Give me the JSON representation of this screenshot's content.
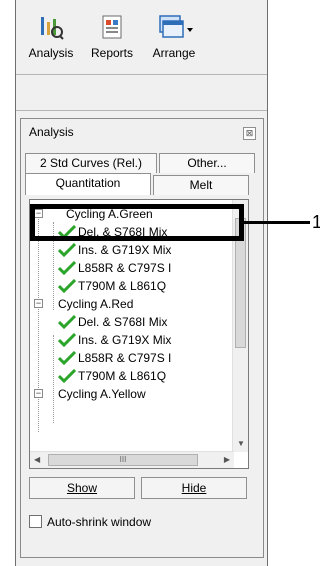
{
  "toolbar": {
    "analysis_label": "Analysis",
    "reports_label": "Reports",
    "arrange_label": "Arrange"
  },
  "dock": {
    "title": "Analysis",
    "close_glyph": "⊠"
  },
  "tabs": {
    "row1": [
      "2 Std Curves (Rel.)",
      "Other..."
    ],
    "row2": [
      "Quantitation",
      "Melt"
    ]
  },
  "tree": {
    "groups": [
      {
        "label": "Cycling A.Green",
        "items": [
          "Del. & S768I Mix",
          "Ins. & G719X Mix",
          "L858R & C797S I",
          "T790M & L861Q"
        ]
      },
      {
        "label": "Cycling A.Red",
        "items": [
          "Del. & S768I Mix",
          "Ins. & G719X Mix",
          "L858R & C797S I",
          "T790M & L861Q"
        ]
      },
      {
        "label": "Cycling A.Yellow",
        "items": []
      }
    ],
    "expand_glyph": "−",
    "hscroll_thumb_glyph": "III"
  },
  "buttons": {
    "show": "Show",
    "hide": "Hide"
  },
  "auto_shrink": {
    "label": "Auto-shrink window",
    "checked": false
  },
  "callout": {
    "number": "1"
  },
  "colors": {
    "check_green": "#2aa52a",
    "highlight": "#000000"
  }
}
